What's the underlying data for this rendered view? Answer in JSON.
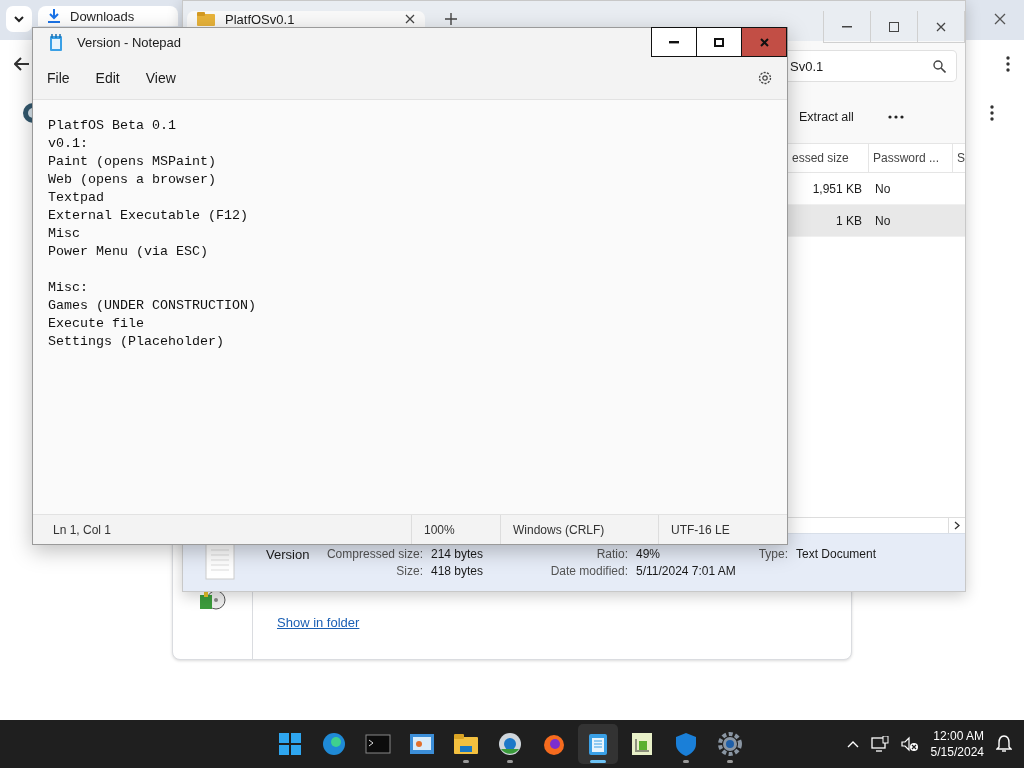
{
  "browser": {
    "tabs": [
      {
        "label": "Downloads",
        "selected": true
      }
    ],
    "download": {
      "action": "Show in folder"
    }
  },
  "explorer": {
    "tab": {
      "label": "PlatfOSv0.1",
      "selected": true
    },
    "search": "Sv0.1",
    "commands": [
      {
        "label": "Extract all"
      }
    ],
    "columns": [
      "essed size",
      "Password ...",
      "S"
    ],
    "rows": [
      {
        "size": "1,951 KB",
        "password": "No",
        "selected": false
      },
      {
        "size": "1 KB",
        "password": "No",
        "selected": true
      }
    ],
    "details": {
      "name": "Version",
      "fields": [
        {
          "label": "Compressed size:",
          "value": "214 bytes"
        },
        {
          "label": "Ratio:",
          "value": "49%"
        },
        {
          "label": "Type:",
          "value": "Text Document"
        },
        {
          "label": "Size:",
          "value": "418 bytes"
        },
        {
          "label": "Date modified:",
          "value": "5/11/2024 7:01 AM"
        }
      ]
    }
  },
  "notepad": {
    "title": "Version - Notepad",
    "menu": [
      "File",
      "Edit",
      "View"
    ],
    "blocks": [
      [
        "PlatfOS Beta 0.1",
        "v0.1:",
        "Paint (opens MSPaint)",
        "Web (opens a browser)",
        "Textpad",
        "External Executable (F12)",
        "Misc",
        "Power Menu (via ESC)"
      ],
      [
        "Misc:",
        "Games (UNDER CONSTRUCTION)",
        "Execute file",
        "Settings (Placeholder)"
      ]
    ],
    "status": [
      "Ln 1, Col 1",
      "100%",
      "Windows (CRLF)",
      "UTF-16 LE"
    ]
  },
  "taskbar": {
    "apps": [
      {
        "kind": "start",
        "running": false,
        "selected": false
      },
      {
        "kind": "edge",
        "running": false,
        "selected": false
      },
      {
        "kind": "terminal",
        "running": false,
        "selected": false
      },
      {
        "kind": "panel",
        "running": false,
        "selected": false
      },
      {
        "kind": "folder",
        "running": true,
        "selected": false
      },
      {
        "kind": "globe",
        "running": true,
        "selected": false
      },
      {
        "kind": "firefox",
        "running": false,
        "selected": false
      },
      {
        "kind": "notepad",
        "running": true,
        "selected": true
      },
      {
        "kind": "chart",
        "running": false,
        "selected": false
      },
      {
        "kind": "shield",
        "running": true,
        "selected": false
      },
      {
        "kind": "gear",
        "running": true,
        "selected": false
      }
    ],
    "clock": {
      "time": "12:00 AM",
      "date": "5/15/2024"
    }
  }
}
